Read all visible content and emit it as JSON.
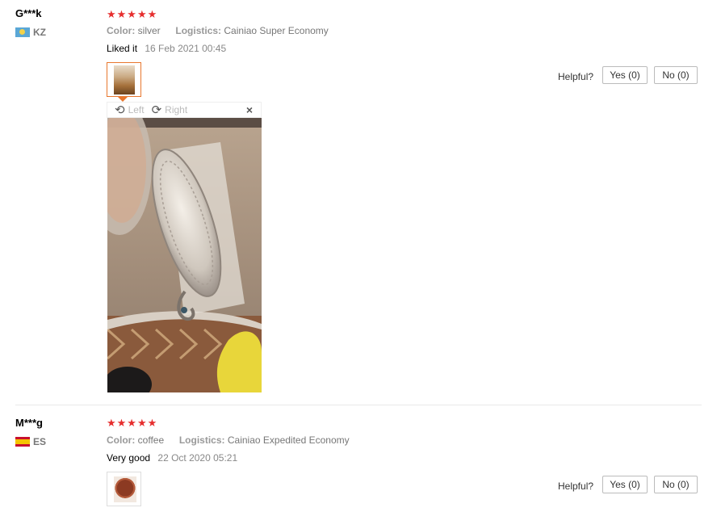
{
  "reviews": [
    {
      "user": "G***k",
      "country": "KZ",
      "stars": "★★★★★",
      "color_label": "Color:",
      "color_value": "silver",
      "logistics_label": "Logistics:",
      "logistics_value": "Cainiao Super Economy",
      "comment": "Liked it",
      "date": "16 Feb 2021 00:45",
      "helpful_label": "Helpful?",
      "yes_label": "Yes (0)",
      "no_label": "No (0)",
      "viewer": {
        "rotate_left_label": "Left",
        "rotate_right_label": "Right",
        "close_glyph": "×"
      }
    },
    {
      "user": "M***g",
      "country": "ES",
      "stars": "★★★★★",
      "color_label": "Color:",
      "color_value": "coffee",
      "logistics_label": "Logistics:",
      "logistics_value": "Cainiao Expedited Economy",
      "comment": "Very good",
      "date": "22 Oct 2020 05:21",
      "helpful_label": "Helpful?",
      "yes_label": "Yes (0)",
      "no_label": "No (0)"
    }
  ],
  "colors": {
    "star": "#e62e2e",
    "active_border": "#e8772e",
    "divider": "#e8e8e8"
  },
  "icons": [
    "rotate-left-icon",
    "rotate-right-icon",
    "close-icon",
    "flag-kz-icon",
    "flag-es-icon"
  ]
}
